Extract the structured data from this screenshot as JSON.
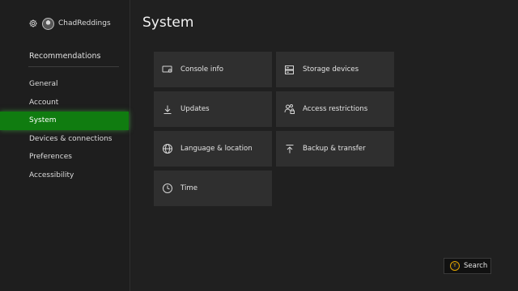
{
  "sidebar": {
    "user": {
      "gamertag": "ChadReddings",
      "settings_icon": "gear-icon"
    },
    "recommendations_label": "Recommendations",
    "items": [
      {
        "label": "General",
        "active": false
      },
      {
        "label": "Account",
        "active": false
      },
      {
        "label": "System",
        "active": true
      },
      {
        "label": "Devices & connections",
        "active": false
      },
      {
        "label": "Preferences",
        "active": false
      },
      {
        "label": "Accessibility",
        "active": false
      }
    ]
  },
  "main": {
    "title": "System",
    "tiles": [
      {
        "label": "Console info",
        "icon": "console-icon"
      },
      {
        "label": "Storage devices",
        "icon": "storage-icon"
      },
      {
        "label": "Updates",
        "icon": "download-icon"
      },
      {
        "label": "Access restrictions",
        "icon": "users-lock-icon"
      },
      {
        "label": "Language & location",
        "icon": "globe-icon"
      },
      {
        "label": "Backup & transfer",
        "icon": "upload-icon"
      },
      {
        "label": "Time",
        "icon": "clock-icon"
      }
    ]
  },
  "footer": {
    "search_label": "Search",
    "search_button_glyph": "Y"
  },
  "colors": {
    "accent": "#107c10",
    "background": "#202020",
    "tile": "#2f2f2f",
    "y_button": "#f2b400"
  }
}
